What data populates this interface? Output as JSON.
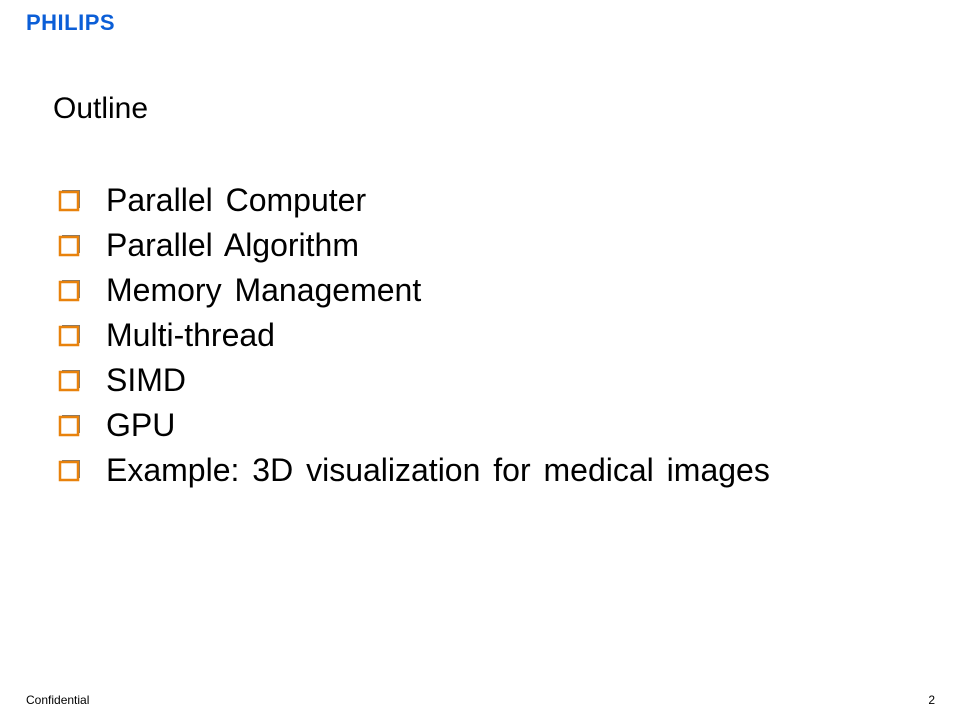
{
  "header": {
    "logo_text": "PHILIPS",
    "brand_color": "#0b5ed7"
  },
  "slide": {
    "title": "Outline",
    "bullet_icon": "hollow-square-icon",
    "bullet_color": "#e8820c",
    "bullets": [
      {
        "label": "Parallel Computer"
      },
      {
        "label": "Parallel Algorithm"
      },
      {
        "label": "Memory Management"
      },
      {
        "label": "Multi-thread"
      },
      {
        "label": "SIMD"
      },
      {
        "label": "GPU"
      },
      {
        "label": "Example: 3D visualization for medical images"
      }
    ]
  },
  "footer": {
    "confidentiality": "Confidential",
    "page_number": "2"
  }
}
